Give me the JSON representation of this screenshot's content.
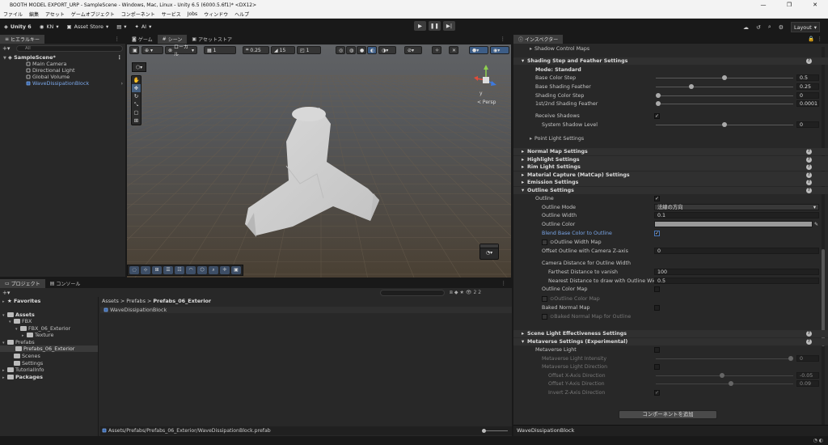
{
  "titlebar": {
    "title": "BOOTH MODEL EXPORT_URP - SampleScene - Windows, Mac, Linux - Unity 6.5 (6000.5.6f1)* <DX12>"
  },
  "menu": [
    "ファイル",
    "編集",
    "アセット",
    "ゲームオブジェクト",
    "コンポーネント",
    "サービス",
    "Jobs",
    "ウィンドウ",
    "ヘルプ"
  ],
  "toolbar": {
    "unity": "Unity 6",
    "account": "KN",
    "asset_store": "Asset Store",
    "ai": "AI",
    "layout": "Layout"
  },
  "hierarchy": {
    "tab": "ヒエラルキー",
    "search_placeholder": "All",
    "scene": "SampleScene*",
    "items": [
      "Main Camera",
      "Directional Light",
      "Global Volume",
      "WaveDissipationBlock"
    ]
  },
  "scene_tabs": [
    "ゲーム",
    "シーン",
    "アセットストア"
  ],
  "scene_toolbar": {
    "pivot": "ローカル",
    "layers": "1",
    "scale": "0.25",
    "num2": "15",
    "num3": "1"
  },
  "scene_view": {
    "persp": "< Persp"
  },
  "project": {
    "tabs": [
      "プロジェクト",
      "コンソール"
    ],
    "favorites": "Favorites",
    "tree": [
      "Assets",
      "FBX",
      "FBX_06_Exterior",
      "Texture",
      "Prefabs",
      "Prefabs_06_Exterior",
      "Scenes",
      "Settings",
      "TutorialInfo",
      "Packages"
    ],
    "breadcrumb": [
      "Assets",
      "Prefabs",
      "Prefabs_06_Exterior"
    ],
    "file": "WaveDissipationBlock",
    "count": "22",
    "path": "Assets/Prefabs/Prefabs_06_Exterior/WaveDissipationBlock.prefab"
  },
  "inspector": {
    "tab": "インスペクター",
    "shadow_control_maps": "Shadow Control Maps",
    "shading_header": "Shading Step and Feather Settings",
    "mode": "Mode: Standard",
    "base_color_step": {
      "label": "Base Color Step",
      "value": "0.5",
      "pos": 0.5
    },
    "base_shading_feather": {
      "label": "Base Shading Feather",
      "value": "0.25",
      "pos": 0.25
    },
    "shading_color_step": {
      "label": "Shading Color Step",
      "value": "0",
      "pos": 0
    },
    "shading_feather_12": {
      "label": "1st/2nd Shading Feather",
      "value": "0.0001",
      "pos": 0
    },
    "receive_shadows": "Receive Shadows",
    "system_shadow_level": {
      "label": "System Shadow Level",
      "value": "0",
      "pos": 0.5
    },
    "point_light": "Point Light Settings",
    "normal_map": "Normal Map Settings",
    "highlight": "Highlight Settings",
    "rim_light": "Rim Light Settings",
    "matcap": "Material Capture (MatCap) Settings",
    "emission": "Emission Settings",
    "outline_header": "Outline Settings",
    "outline": "Outline",
    "outline_mode": {
      "label": "Outline Mode",
      "value": "法線の方向"
    },
    "outline_width": {
      "label": "Outline Width",
      "value": "0.1"
    },
    "outline_color": "Outline Color",
    "blend_base": "Blend Base Color to Outline",
    "outline_width_map": "⊙Outline Width Map",
    "offset_outline": {
      "label": "Offset Outline with Camera Z-axis",
      "value": "0"
    },
    "camera_distance": "Camera Distance for Outline Width",
    "farthest": {
      "label": "Farthest Distance to vanish",
      "value": "100"
    },
    "nearest": {
      "label": "Nearest Distance to draw with Outline Width",
      "value": "0.5"
    },
    "outline_color_map": "Outline Color Map",
    "outline_color_map_sub": "⊙Outline Color Map",
    "baked_normal": "Baked Normal Map",
    "baked_normal_sub": "⊙Baked Normal Map for Outline",
    "scene_light": "Scene Light Effectiveness Settings",
    "metaverse_header": "Metaverse Settings (Experimental)",
    "metaverse_light": "Metaverse Light",
    "metaverse_intensity": {
      "label": "Metaverse Light Intensity",
      "value": "0",
      "pos": 1
    },
    "metaverse_direction": "Metaverse Light Direction",
    "offset_x": {
      "label": "Offset X-Axis Direction",
      "value": "-0.05",
      "pos": 0.48
    },
    "offset_y": {
      "label": "Offset Y-Axis Direction",
      "value": "0.09",
      "pos": 0.55
    },
    "invert_z": "Invert Z-Axis Direction",
    "add_component": "コンポーネントを追加",
    "footer": "WaveDissipationBlock"
  }
}
